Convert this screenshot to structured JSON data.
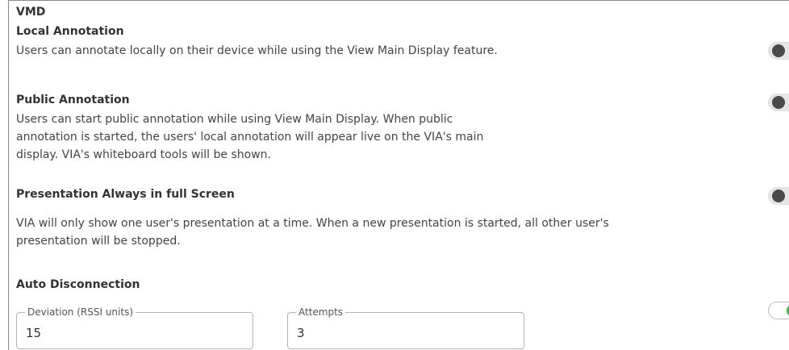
{
  "section": {
    "title": "VMD"
  },
  "settings": [
    {
      "title": "Local Annotation",
      "description": "Users can annotate locally on their device while using the View Main Display feature.",
      "enabled": false
    },
    {
      "title": "Public Annotation",
      "description_lines": [
        "Users can start public annotation while using View Main Display. When public",
        "annotation is started, the users' local annotation will appear live on the VIA's main",
        "display. VIA's whiteboard tools will be shown."
      ],
      "enabled": false
    },
    {
      "title": "Presentation Always in full Screen",
      "description_lines": [
        "VIA will only show one user's presentation at a time. When a new presentation is started, all other user's",
        "presentation will be stopped."
      ],
      "enabled": false
    },
    {
      "title": "Auto Disconnection",
      "enabled": true
    }
  ],
  "fields": {
    "deviation": {
      "label": "Deviation (RSSI units)",
      "value": "15"
    },
    "attempts": {
      "label": "Attempts",
      "value": "3"
    }
  },
  "colors": {
    "toggle_on": "#3cb64a",
    "toggle_off_knob": "#4a4a4a",
    "border": "#8a8a8a"
  }
}
